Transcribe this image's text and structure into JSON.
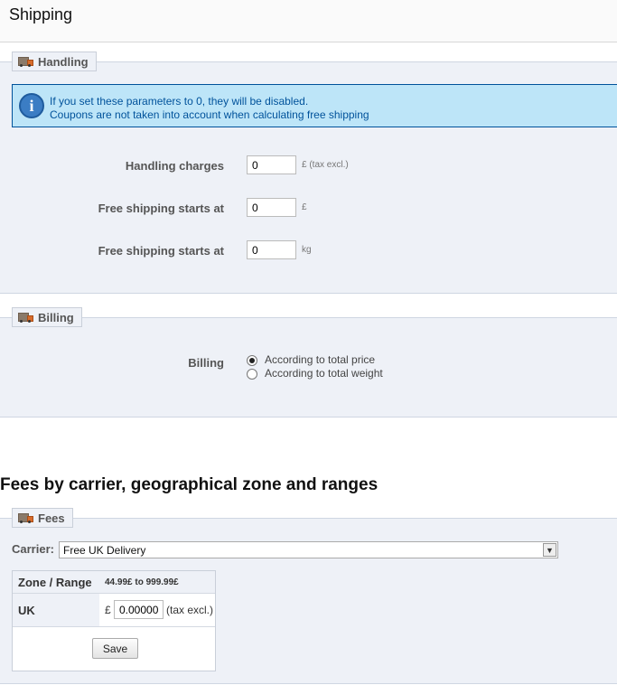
{
  "header": {
    "title": "Shipping"
  },
  "handling": {
    "legend": "Handling",
    "info_line1": "If you set these parameters to 0, they will be disabled.",
    "info_line2": "Coupons are not taken into account when calculating free shipping",
    "fields": [
      {
        "label": "Handling charges",
        "value": "0",
        "unit": "£ (tax excl.)"
      },
      {
        "label": "Free shipping starts at",
        "value": "0",
        "unit": "£"
      },
      {
        "label": "Free shipping starts at",
        "value": "0",
        "unit": "kg"
      }
    ]
  },
  "billing": {
    "legend": "Billing",
    "label": "Billing",
    "options": [
      {
        "label": "According to total price",
        "checked": true
      },
      {
        "label": "According to total weight",
        "checked": false
      }
    ]
  },
  "fees_section": {
    "heading": "Fees by carrier, geographical zone and ranges",
    "legend": "Fees",
    "carrier_label": "Carrier:",
    "carrier_selected": "Free UK Delivery",
    "table": {
      "header_col1": "Zone / Range",
      "header_col2": "44.99£ to 999.99£",
      "zone": "UK",
      "currency": "£",
      "value": "0.00000",
      "tax": "(tax excl.)"
    },
    "save_label": "Save"
  },
  "icons": {
    "legend": "truck-icon",
    "info": "info-icon",
    "dropdown": "chevron-down-icon"
  },
  "colors": {
    "info_bg": "#bde5f8",
    "info_text": "#00529b",
    "panel_bg": "#eef1f7"
  }
}
